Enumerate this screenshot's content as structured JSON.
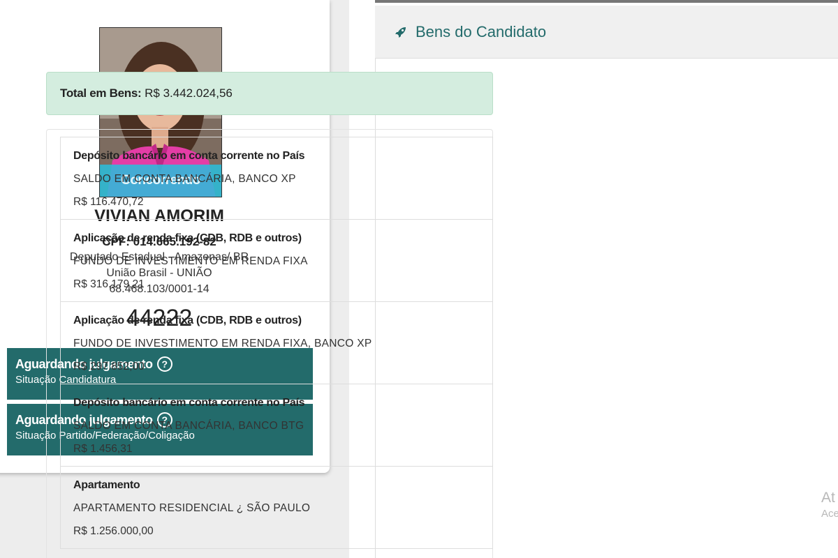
{
  "candidate": {
    "photo_badge": "Concorrendo",
    "name": "VIVIAN AMORIM",
    "cpf": "CPF: 014.665.192-82",
    "office": "Deputado Estadual - Amazonas/ BR",
    "party": "União Brasil - UNIÃO",
    "cnpj": "68.468.103/0001-14",
    "number": "44222"
  },
  "status": [
    {
      "title": "Aguardando julgamento",
      "subtitle": "Situação Candidatura",
      "icon": "question-circle-icon"
    },
    {
      "title": "Aguardando julgamento",
      "subtitle": "Situação Partido/Federação/Coligação",
      "icon": "question-circle-icon"
    }
  ],
  "assets_panel": {
    "title": "Bens do Candidato",
    "icon": "rocket-icon",
    "total_label": "Total em Bens:",
    "total_value": "R$ 3.442.024,56",
    "items": [
      {
        "type": "Depósito bancário em conta corrente no País",
        "description": "SALDO EM CONTA BANCÁRIA, BANCO XP",
        "value": "R$ 116.470,72"
      },
      {
        "type": "Aplicação de renda fixa (CDB, RDB e outros)",
        "description": "FUNDO DE INVESTIMENTO EM RENDA FIXA",
        "value": "R$ 316.179,21"
      },
      {
        "type": "Aplicação de renda fixa (CDB, RDB e outros)",
        "description": "FUNDO DE INVESTIMENTO EM RENDA FIXA, BANCO XP",
        "value": "R$ 297.852,00"
      },
      {
        "type": "Depósito bancário em conta corrente no País",
        "description": "SALDO EM CONTA BANCÁRIA, BANCO BTG",
        "value": "R$ 1.456,31"
      },
      {
        "type": "Apartamento",
        "description": "APARTAMENTO RESIDENCIAL ¿ SÃO PAULO",
        "value": "R$ 1.256.000,00"
      }
    ]
  },
  "watermark": {
    "line1": "At",
    "line2": "Ace"
  },
  "colors": {
    "accent": "#236b6b",
    "success_bg": "#d4eddf",
    "badge": "#28bedc"
  }
}
